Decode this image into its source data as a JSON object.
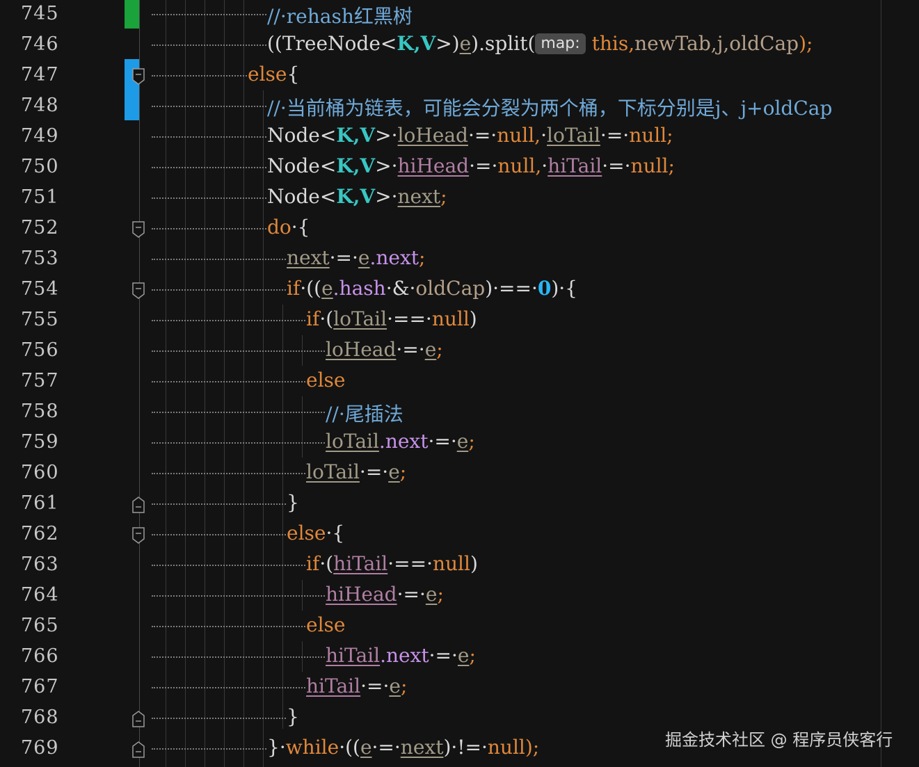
{
  "colors": {
    "background": "#131313",
    "keyword": "#e0883b",
    "comment": "#6fa9d8",
    "type_param": "#38c7c3",
    "field": "#c792ea",
    "local_var": "#a29b88",
    "number": "#29b6f6",
    "vcs_added": "#1aa33a",
    "vcs_modified": "#1e9be6"
  },
  "editor": {
    "lines": [
      {
        "n": "745",
        "t": "// rehash红黑树"
      },
      {
        "n": "746",
        "t": "((TreeNode<K,V>)e).split( map: this, newTab, j, oldCap);"
      },
      {
        "n": "747",
        "t": "else {"
      },
      {
        "n": "748",
        "t": "// 当前桶为链表，可能会分裂为两个桶，下标分别是j、j+oldCap"
      },
      {
        "n": "749",
        "t": "Node<K,V> loHead = null, loTail = null;"
      },
      {
        "n": "750",
        "t": "Node<K,V> hiHead = null, hiTail = null;"
      },
      {
        "n": "751",
        "t": "Node<K,V> next;"
      },
      {
        "n": "752",
        "t": "do {"
      },
      {
        "n": "753",
        "t": "next = e.next;"
      },
      {
        "n": "754",
        "t": "if ((e.hash & oldCap) == 0) {"
      },
      {
        "n": "755",
        "t": "if (loTail == null)"
      },
      {
        "n": "756",
        "t": "loHead = e;"
      },
      {
        "n": "757",
        "t": "else"
      },
      {
        "n": "758",
        "t": "// 尾插法"
      },
      {
        "n": "759",
        "t": "loTail.next = e;"
      },
      {
        "n": "760",
        "t": "loTail = e;"
      },
      {
        "n": "761",
        "t": "}"
      },
      {
        "n": "762",
        "t": "else {"
      },
      {
        "n": "763",
        "t": "if (hiTail == null)"
      },
      {
        "n": "764",
        "t": "hiHead = e;"
      },
      {
        "n": "765",
        "t": "else"
      },
      {
        "n": "766",
        "t": "hiTail.next = e;"
      },
      {
        "n": "767",
        "t": "hiTail = e;"
      },
      {
        "n": "768",
        "t": "}"
      },
      {
        "n": "769",
        "t": "} while ((e = next) != null);"
      }
    ]
  },
  "tokens": {
    "l745": {
      "c": "//·rehash红黑树"
    },
    "l746": {
      "a": "((TreeNode<",
      "tk": "K",
      "comma": ",",
      "tv": "V",
      "b": ">)",
      "e": "e",
      "c": ").split(",
      "hint": "map:",
      "this": "this,",
      "p1": "newTab,",
      "p2": "j,",
      "p3": "oldCap",
      "end": ");"
    },
    "l747": {
      "k": "else",
      "b": "{"
    },
    "l748": {
      "c": "//·当前桶为链表，可能会分裂为两个桶，下标分别是j、j+oldCap"
    },
    "l749": {
      "a": "Node<",
      "tk": "K",
      "comma": ",",
      "tv": "V",
      "b": ">·",
      "v1": "loHead",
      "eq1": "·=·",
      "n1": "null,",
      "sp": "·",
      "v2": "loTail",
      "eq2": "·=·",
      "n2": "null;"
    },
    "l750": {
      "a": "Node<",
      "tk": "K",
      "comma": ",",
      "tv": "V",
      "b": ">·",
      "v1": "hiHead",
      "eq1": "·=·",
      "n1": "null,",
      "sp": "·",
      "v2": "hiTail",
      "eq2": "·=·",
      "n2": "null;"
    },
    "l751": {
      "a": "Node<",
      "tk": "K",
      "comma": ",",
      "tv": "V",
      "b": ">·",
      "v1": "next",
      "end": ";"
    },
    "l752": {
      "k": "do",
      "b": "·{"
    },
    "l753": {
      "v1": "next",
      "eq": "·=·",
      "v2": "e",
      "f": ".next",
      "end": ";"
    },
    "l754": {
      "k": "if",
      "a": "·((",
      "v": "e",
      "f": ".hash",
      "op": "·&·",
      "p": "oldCap",
      "b": ")·==·",
      "num": "0",
      "c": ")·{"
    },
    "l755": {
      "k": "if",
      "a": "·(",
      "v": "loTail",
      "b": "·==·",
      "n": "null",
      "c": ")"
    },
    "l756": {
      "v1": "loHead",
      "eq": "·=·",
      "v2": "e",
      "end": ";"
    },
    "l757": {
      "k": "else"
    },
    "l758": {
      "c": "//·尾插法"
    },
    "l759": {
      "v1": "loTail",
      "f": ".next",
      "eq": "·=·",
      "v2": "e",
      "end": ";"
    },
    "l760": {
      "v1": "loTail",
      "eq": "·=·",
      "v2": "e",
      "end": ";"
    },
    "l761": {
      "b": "}"
    },
    "l762": {
      "k": "else",
      "b": "·{"
    },
    "l763": {
      "k": "if",
      "a": "·(",
      "v": "hiTail",
      "b": "·==·",
      "n": "null",
      "c": ")"
    },
    "l764": {
      "v1": "hiHead",
      "eq": "·=·",
      "v2": "e",
      "end": ";"
    },
    "l765": {
      "k": "else"
    },
    "l766": {
      "v1": "hiTail",
      "f": ".next",
      "eq": "·=·",
      "v2": "e",
      "end": ";"
    },
    "l767": {
      "v1": "hiTail",
      "eq": "·=·",
      "v2": "e",
      "end": ";"
    },
    "l768": {
      "b": "}"
    },
    "l769": {
      "a": "}·",
      "k": "while",
      "b": "·((",
      "v1": "e",
      "eq": "·=·",
      "v2": "next",
      "c": ")·!=·",
      "n": "null",
      "end": ");"
    }
  },
  "watermark": "掘金技术社区 @ 程序员侠客行"
}
